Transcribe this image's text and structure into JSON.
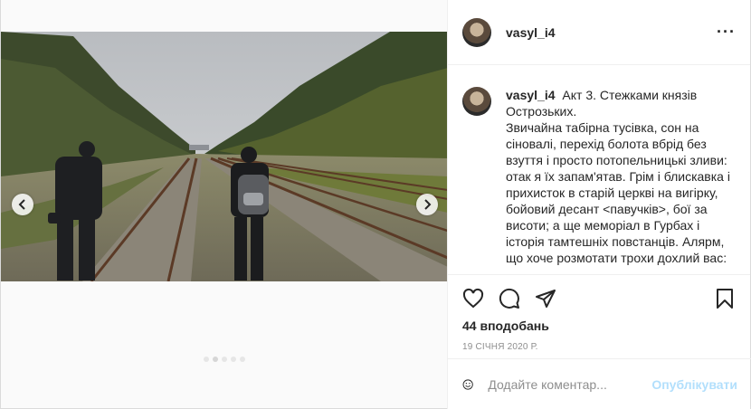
{
  "post": {
    "username": "vasyl_i4",
    "more_icon": "ellipsis-icon",
    "caption_title": "Акт 3. Стежками князів Острозьких.",
    "caption_body": "Звичайна табірна тусівка, сон на сіновалі, перехід болота вбрід без взуття і просто потопельницькі зливи: отак я їх запам'ятав. Грім і блискавка і прихисток в старій церкві на вигірку, бойовий десант <павучків>, бої за висоти; а ще меморіал в Гурбах і історія тамтешніх повстанців. Алярм, що хоче розмотати трохи дохлий вас:",
    "likes": "44 вподобань",
    "date": "19 СІЧНЯ 2020 Р."
  },
  "comment_box": {
    "placeholder": "Додайте коментар...",
    "post_label": "Опублікувати"
  },
  "carousel": {
    "slide_count": 5,
    "active_index": 1
  },
  "colors": {
    "accent_disabled": "#b2dffc",
    "muted_text": "#8e8e8e",
    "border": "#dbdbdb"
  }
}
